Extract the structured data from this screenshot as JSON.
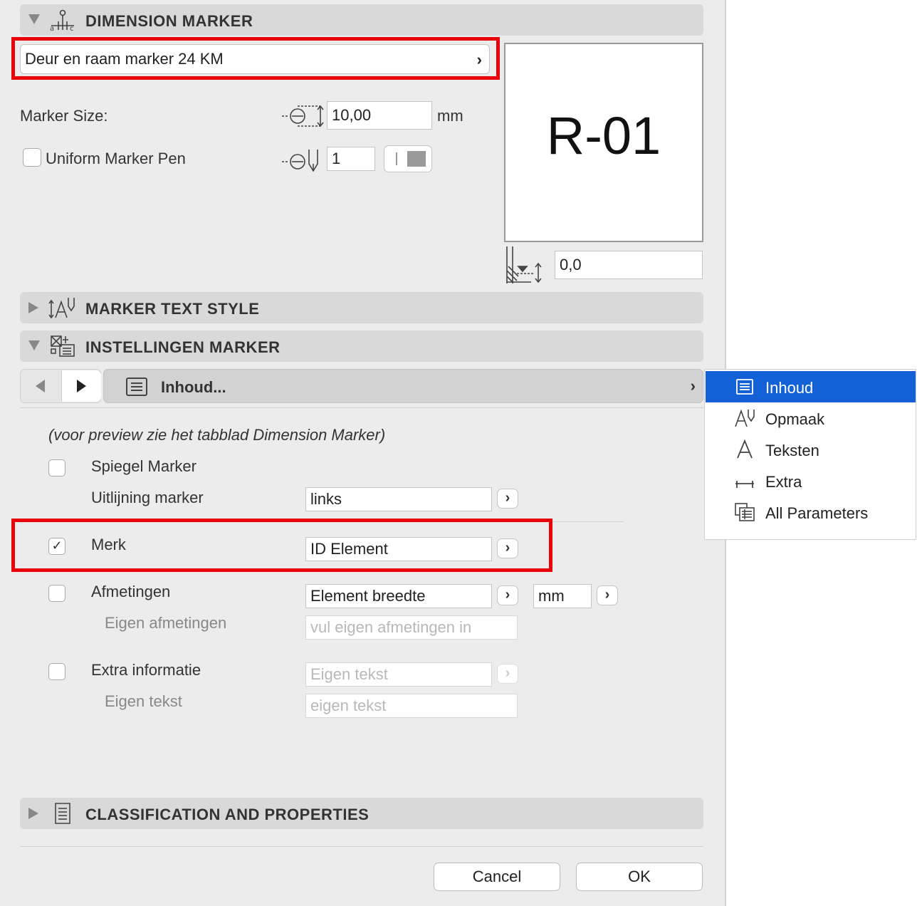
{
  "dimension_marker": {
    "title": "DIMENSION MARKER",
    "marker_type": "Deur en raam marker 24 KM",
    "marker_size_label": "Marker Size:",
    "marker_size_value": "10,00",
    "marker_size_unit": "mm",
    "uniform_pen_label": "Uniform Marker Pen",
    "uniform_pen_checked": false,
    "pen_value": "1",
    "preview_text": "R-01",
    "offset_value": "0,0"
  },
  "marker_text_style": {
    "title": "MARKER TEXT STYLE"
  },
  "instellingen_marker": {
    "title": "INSTELLINGEN MARKER",
    "page_selector": "Inhoud...",
    "note": "(voor preview zie het tabblad Dimension Marker)",
    "spiegel_label": "Spiegel Marker",
    "uitlijning_label": "Uitlijning marker",
    "uitlijning_value": "links",
    "merk_label": "Merk",
    "merk_checked": true,
    "merk_value": "ID Element",
    "afmetingen_label": "Afmetingen",
    "afmetingen_value": "Element breedte",
    "afmetingen_unit": "mm",
    "eigen_afmetingen_label": "Eigen afmetingen",
    "eigen_afmetingen_placeholder": "vul eigen afmetingen in",
    "extra_info_label": "Extra informatie",
    "extra_info_value": "Eigen tekst",
    "eigen_tekst_label": "Eigen tekst",
    "eigen_tekst_placeholder": "eigen tekst"
  },
  "classification": {
    "title": "CLASSIFICATION AND PROPERTIES"
  },
  "buttons": {
    "cancel": "Cancel",
    "ok": "OK"
  },
  "menu": {
    "items": [
      {
        "label": "Inhoud",
        "icon": "list-icon",
        "selected": true
      },
      {
        "label": "Opmaak",
        "icon": "text-style-icon",
        "selected": false
      },
      {
        "label": "Teksten",
        "icon": "letter-a-icon",
        "selected": false
      },
      {
        "label": "Extra",
        "icon": "dimension-line-icon",
        "selected": false
      },
      {
        "label": "All Parameters",
        "icon": "parameters-table-icon",
        "selected": false
      }
    ]
  },
  "colors": {
    "selection": "#1460d6",
    "highlight_box": "#e8000b"
  }
}
